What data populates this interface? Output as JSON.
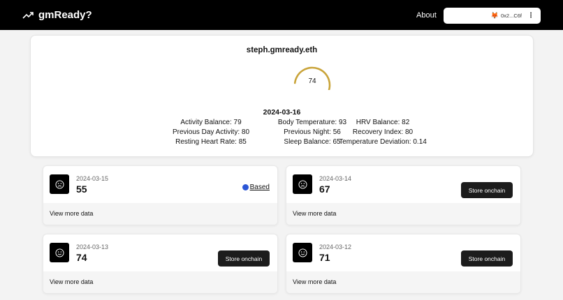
{
  "header": {
    "brand": "gmReady?",
    "about_label": "About",
    "wallet_fox": "🦊",
    "wallet_address": "0x2...C6f",
    "wallet_menu": "⋮"
  },
  "summary": {
    "ens_name": "steph.gmready.eth",
    "score": "74",
    "date": "2024-03-16",
    "metrics_col1": [
      "Activity Balance: 79",
      "Previous Day Activity: 80",
      "Resting Heart Rate: 85"
    ],
    "metrics_col2": [
      "Body Temperature: 93",
      "Previous Night: 56",
      "Sleep Balance: 65"
    ],
    "metrics_col3": [
      "HRV Balance: 82",
      "Recovery Index: 80",
      "Temperature Deviation: 0.14"
    ],
    "gauge_color": "#c9a43a"
  },
  "cards": [
    {
      "date": "2024-03-15",
      "score": "55",
      "mood": "sad",
      "action": "based",
      "action_label": "Based",
      "footer": "View more data"
    },
    {
      "date": "2024-03-14",
      "score": "67",
      "mood": "sad",
      "action": "store",
      "action_label": "Store onchain",
      "footer": "View more data"
    },
    {
      "date": "2024-03-13",
      "score": "74",
      "mood": "happy",
      "action": "store",
      "action_label": "Store onchain",
      "footer": "View more data"
    },
    {
      "date": "2024-03-12",
      "score": "71",
      "mood": "happy",
      "action": "store",
      "action_label": "Store onchain",
      "footer": "View more data"
    }
  ]
}
